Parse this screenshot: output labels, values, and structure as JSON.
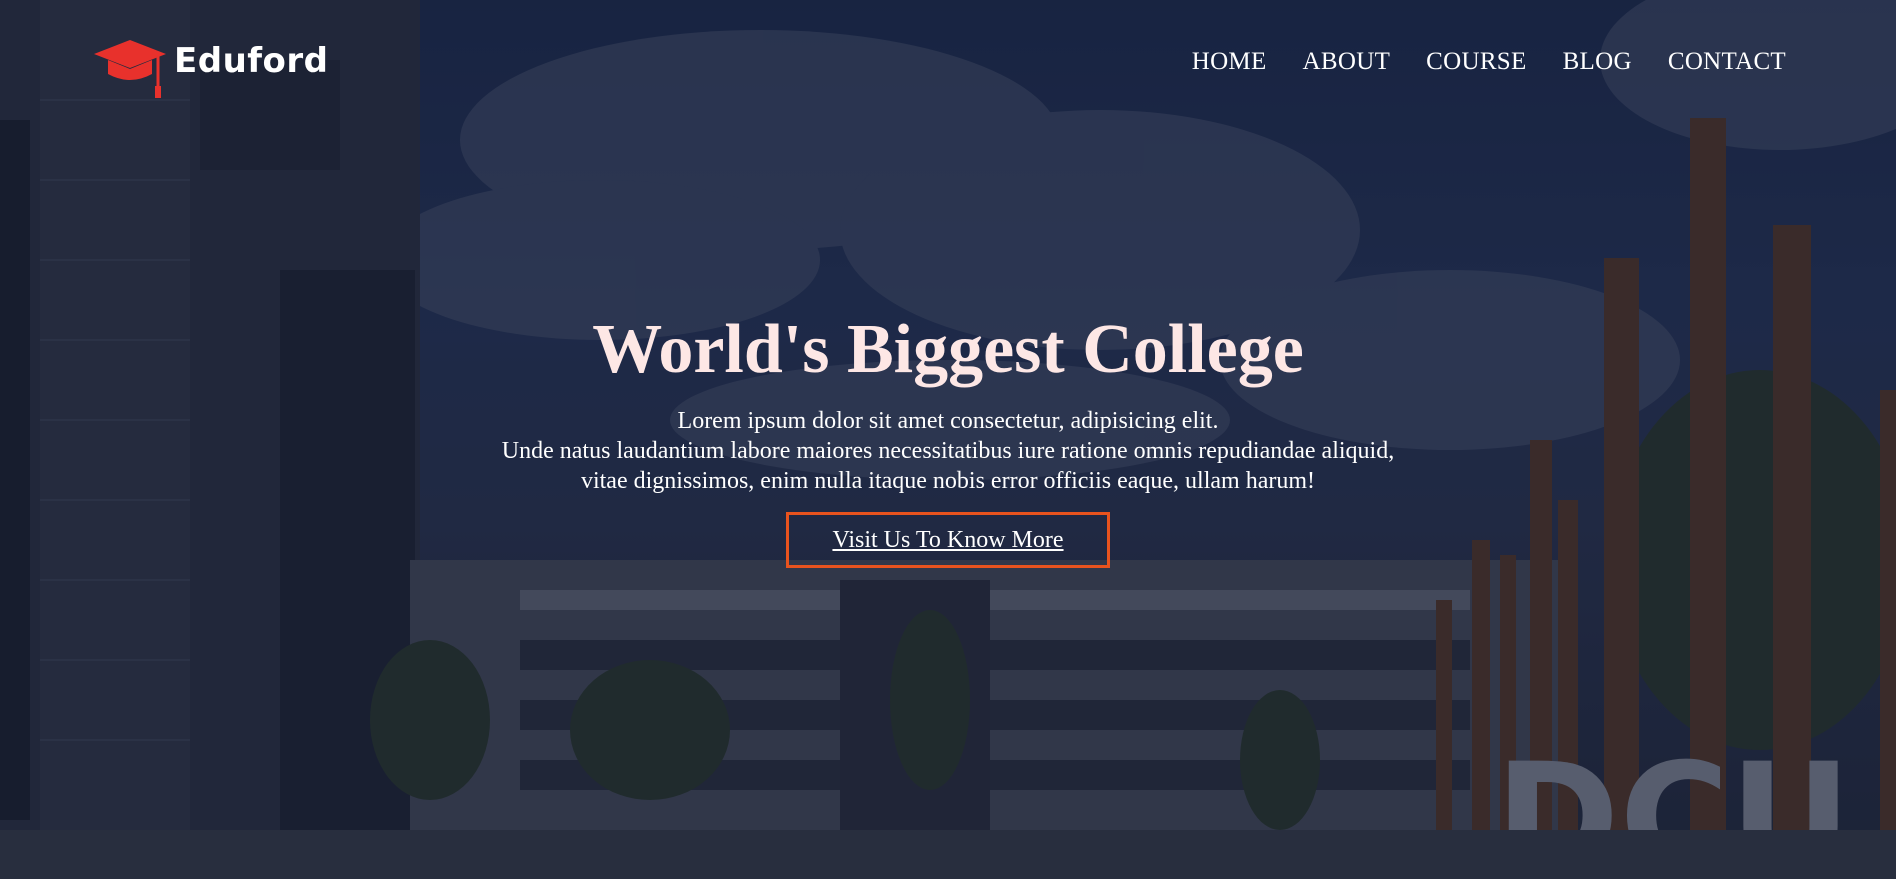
{
  "brand": {
    "name": "Eduford",
    "icon": "graduation-cap-icon",
    "icon_color": "#e8312c"
  },
  "nav": {
    "items": [
      {
        "label": "HOME"
      },
      {
        "label": "ABOUT"
      },
      {
        "label": "COURSE"
      },
      {
        "label": "BLOG"
      },
      {
        "label": "CONTACT"
      }
    ]
  },
  "hero": {
    "title": "World's Biggest College",
    "lines": [
      "Lorem ipsum dolor sit amet consectetur, adipisicing elit.",
      "Unde natus laudantium labore maiores necessitatibus iure ratione omnis repudiandae aliquid,",
      "vitae dignissimos, enim nulla itaque nobis error officiis eaque, ullam harum!"
    ],
    "cta_label": "Visit Us To Know More",
    "cta_border_color": "#e8531e",
    "background_signage": "DCU"
  },
  "colors": {
    "title": "#fde7e5",
    "overlay": "#141a32"
  }
}
